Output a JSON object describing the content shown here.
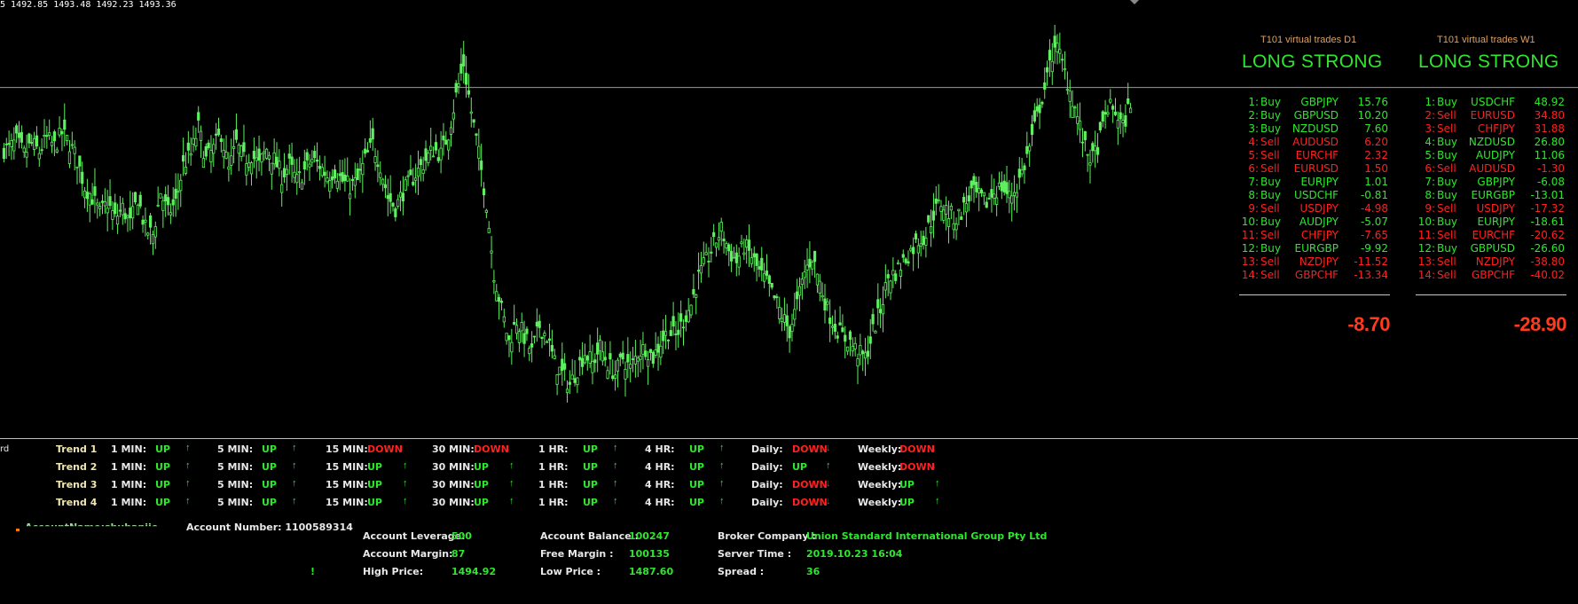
{
  "header": {
    "ohlc_text": "5  1492.85 1493.48 1492.23 1493.36"
  },
  "colors": {
    "background": "#000000",
    "candle": "#5ef05e",
    "bull": "#2ee62e",
    "bear": "#ff2020",
    "accent_orange": "#e0a060",
    "total_red": "#ff3b1f"
  },
  "chart": {
    "type": "candlestick",
    "price_range": {
      "high": 1494.92,
      "low": 1487.6
    },
    "horizontal_line": "1493.75",
    "closes": [
      1492.6,
      1492.75,
      1492.5,
      1492.7,
      1492.55,
      1492.8,
      1492.65,
      1492.9,
      1492.7,
      1492.4,
      1491.9,
      1491.7,
      1491.4,
      1491.6,
      1491.3,
      1491.5,
      1491.2,
      1491.7,
      1491.1,
      1491.0,
      1491.8,
      1491.4,
      1491.6,
      1492.3,
      1492.5,
      1493.0,
      1492.4,
      1492.6,
      1492.9,
      1492.2,
      1492.7,
      1492.4,
      1492.5,
      1492.3,
      1492.6,
      1492.4,
      1492.1,
      1492.3,
      1492.0,
      1492.2,
      1492.4,
      1492.3,
      1492.1,
      1492.2,
      1492.0,
      1491.9,
      1492.0,
      1492.4,
      1492.7,
      1492.3,
      1491.7,
      1491.5,
      1491.8,
      1492.0,
      1492.2,
      1492.4,
      1492.6,
      1492.5,
      1492.9,
      1493.6,
      1494.2,
      1493.3,
      1492.5,
      1491.6,
      1490.3,
      1489.6,
      1489.0,
      1489.4,
      1489.1,
      1488.8,
      1489.3,
      1489.1,
      1488.6,
      1488.4,
      1488.2,
      1488.5,
      1488.8,
      1488.6,
      1488.9,
      1488.6,
      1488.4,
      1488.7,
      1488.5,
      1488.8,
      1488.9,
      1488.7,
      1489.0,
      1489.2,
      1489.1,
      1489.4,
      1489.7,
      1490.2,
      1490.5,
      1490.8,
      1491.1,
      1490.7,
      1490.5,
      1490.8,
      1490.6,
      1490.3,
      1490.1,
      1489.8,
      1489.5,
      1489.2,
      1489.7,
      1490.3,
      1490.6,
      1490.1,
      1489.6,
      1489.3,
      1489.1,
      1489.0,
      1488.8,
      1488.7,
      1489.2,
      1489.6,
      1490.2,
      1490.3,
      1490.5,
      1490.7,
      1490.9,
      1491.0,
      1491.4,
      1491.6,
      1491.4,
      1491.3,
      1491.5,
      1491.8,
      1491.7,
      1491.6,
      1491.8,
      1491.9,
      1491.7,
      1491.9,
      1492.3,
      1492.8,
      1493.4,
      1493.9,
      1494.6,
      1494.2,
      1493.7,
      1493.2,
      1492.6,
      1492.4,
      1492.8,
      1493.4,
      1493.3,
      1493.0,
      1493.5
    ]
  },
  "panels": [
    {
      "title": "T101 virtual trades D1",
      "status": "LONG STRONG",
      "trades": [
        {
          "n": "1:",
          "side": "Buy",
          "pair": "GBPJPY",
          "value": "15.76"
        },
        {
          "n": "2:",
          "side": "Buy",
          "pair": "GBPUSD",
          "value": "10.20"
        },
        {
          "n": "3:",
          "side": "Buy",
          "pair": "NZDUSD",
          "value": "7.60"
        },
        {
          "n": "4:",
          "side": "Sell",
          "pair": "AUDUSD",
          "value": "6.20"
        },
        {
          "n": "5:",
          "side": "Sell",
          "pair": "EURCHF",
          "value": "2.32"
        },
        {
          "n": "6:",
          "side": "Sell",
          "pair": "EURUSD",
          "value": "1.50"
        },
        {
          "n": "7:",
          "side": "Buy",
          "pair": "EURJPY",
          "value": "1.01"
        },
        {
          "n": "8:",
          "side": "Buy",
          "pair": "USDCHF",
          "value": "-0.81"
        },
        {
          "n": "9:",
          "side": "Sell",
          "pair": "USDJPY",
          "value": "-4.98"
        },
        {
          "n": "10:",
          "side": "Buy",
          "pair": "AUDJPY",
          "value": "-5.07"
        },
        {
          "n": "11:",
          "side": "Sell",
          "pair": "CHFJPY",
          "value": "-7.65"
        },
        {
          "n": "12:",
          "side": "Buy",
          "pair": "EURGBP",
          "value": "-9.92"
        },
        {
          "n": "13:",
          "side": "Sell",
          "pair": "NZDJPY",
          "value": "-11.52"
        },
        {
          "n": "14:",
          "side": "Sell",
          "pair": "GBPCHF",
          "value": "-13.34"
        }
      ],
      "total": "-8.70"
    },
    {
      "title": "T101 virtual trades W1",
      "status": "LONG STRONG",
      "trades": [
        {
          "n": "1:",
          "side": "Buy",
          "pair": "USDCHF",
          "value": "48.92"
        },
        {
          "n": "2:",
          "side": "Sell",
          "pair": "EURUSD",
          "value": "34.80"
        },
        {
          "n": "3:",
          "side": "Sell",
          "pair": "CHFJPY",
          "value": "31.88"
        },
        {
          "n": "4:",
          "side": "Buy",
          "pair": "NZDUSD",
          "value": "26.80"
        },
        {
          "n": "5:",
          "side": "Buy",
          "pair": "AUDJPY",
          "value": "11.06"
        },
        {
          "n": "6:",
          "side": "Sell",
          "pair": "AUDUSD",
          "value": "-1.30"
        },
        {
          "n": "7:",
          "side": "Buy",
          "pair": "GBPJPY",
          "value": "-6.08"
        },
        {
          "n": "8:",
          "side": "Buy",
          "pair": "EURGBP",
          "value": "-13.01"
        },
        {
          "n": "9:",
          "side": "Sell",
          "pair": "USDJPY",
          "value": "-17.32"
        },
        {
          "n": "10:",
          "side": "Buy",
          "pair": "EURJPY",
          "value": "-18.61"
        },
        {
          "n": "11:",
          "side": "Sell",
          "pair": "EURCHF",
          "value": "-20.62"
        },
        {
          "n": "12:",
          "side": "Buy",
          "pair": "GBPUSD",
          "value": "-26.60"
        },
        {
          "n": "13:",
          "side": "Sell",
          "pair": "NZDJPY",
          "value": "-38.80"
        },
        {
          "n": "14:",
          "side": "Sell",
          "pair": "GBPCHF",
          "value": "-40.02"
        }
      ],
      "total": "-28.90"
    }
  ],
  "trend_edge_text": "rd",
  "trends": [
    {
      "label": "Trend 1",
      "cells": [
        {
          "tf": "1 MIN:",
          "dir": "UP"
        },
        {
          "tf": "5 MIN:",
          "dir": "UP"
        },
        {
          "tf": "15 MIN:",
          "dir": "DOWN"
        },
        {
          "tf": "30 MIN:",
          "dir": "DOWN"
        },
        {
          "tf": "1 HR:",
          "dir": "UP"
        },
        {
          "tf": "4 HR:",
          "dir": "UP"
        },
        {
          "tf": "Daily:",
          "dir": "DOWN"
        },
        {
          "tf": "Weekly:",
          "dir": "DOWN"
        }
      ]
    },
    {
      "label": "Trend 2",
      "cells": [
        {
          "tf": "1 MIN:",
          "dir": "UP"
        },
        {
          "tf": "5 MIN:",
          "dir": "UP"
        },
        {
          "tf": "15 MIN:",
          "dir": "UP"
        },
        {
          "tf": "30 MIN:",
          "dir": "UP"
        },
        {
          "tf": "1 HR:",
          "dir": "UP"
        },
        {
          "tf": "4 HR:",
          "dir": "UP"
        },
        {
          "tf": "Daily:",
          "dir": "UP"
        },
        {
          "tf": "Weekly:",
          "dir": "DOWN"
        }
      ]
    },
    {
      "label": "Trend 3",
      "cells": [
        {
          "tf": "1 MIN:",
          "dir": "UP"
        },
        {
          "tf": "5 MIN:",
          "dir": "UP"
        },
        {
          "tf": "15 MIN:",
          "dir": "UP"
        },
        {
          "tf": "30 MIN:",
          "dir": "UP"
        },
        {
          "tf": "1 HR:",
          "dir": "UP"
        },
        {
          "tf": "4 HR:",
          "dir": "UP"
        },
        {
          "tf": "Daily:",
          "dir": "DOWN"
        },
        {
          "tf": "Weekly:",
          "dir": "UP"
        }
      ]
    },
    {
      "label": "Trend 4",
      "cells": [
        {
          "tf": "1 MIN:",
          "dir": "UP"
        },
        {
          "tf": "5 MIN:",
          "dir": "UP"
        },
        {
          "tf": "15 MIN:",
          "dir": "UP"
        },
        {
          "tf": "30 MIN:",
          "dir": "UP"
        },
        {
          "tf": "1 HR:",
          "dir": "UP"
        },
        {
          "tf": "4 HR:",
          "dir": "UP"
        },
        {
          "tf": "Daily:",
          "dir": "DOWN"
        },
        {
          "tf": "Weekly:",
          "dir": "UP"
        }
      ]
    }
  ],
  "account": {
    "partial_left": "AccountName:shuhanjie",
    "partial_number": "Account Number: 1100589314",
    "leverage_label": "Account Leverage:",
    "leverage_value": "500",
    "margin_label": "Account Margin:",
    "margin_value": "87",
    "high_label": "High Price:",
    "high_value": "1494.92",
    "balance_label": "Account Balance :",
    "balance_value": "100247",
    "free_label": "Free Margin :",
    "free_value": "100135",
    "low_label": "Low Price :",
    "low_value": "1487.60",
    "broker_label": "Broker Company :",
    "broker_value": "Union Standard International Group Pty Ltd",
    "time_label": "Server Time :",
    "time_value": "2019.10.23 16:04",
    "spread_label": "Spread :",
    "spread_value": "36",
    "stray_mark": "!"
  }
}
